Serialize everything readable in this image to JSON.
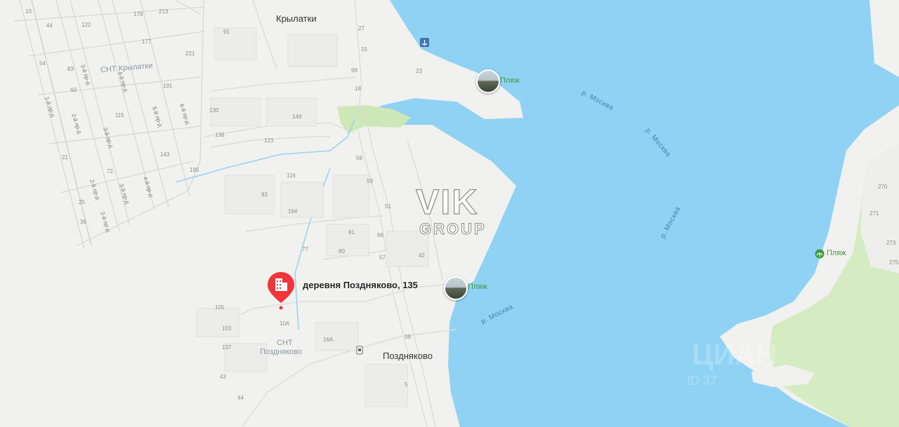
{
  "map": {
    "places": {
      "krylatki": "Крылатки",
      "pozdnyakovo": "Поздняково",
      "snt_krylatki": "СНТ Крылатки",
      "snt_pozdnyakovo_line1": "СНТ",
      "snt_pozdnyakovo_line2": "Поздняково"
    },
    "river_labels": [
      "р. Москва",
      "р. Москва",
      "р. Москва",
      "р. Москва"
    ],
    "beaches": [
      "Пляж",
      "Пляж",
      "Пляж"
    ],
    "address_marker": {
      "label": "деревня Поздняково, 135",
      "icon": "building-icon"
    },
    "watermark": {
      "line1": "VIK",
      "line2": "GROUP"
    },
    "cian_watermark": {
      "text": "ЦИАН",
      "id": "ID 37"
    },
    "streets": [
      "1-й пр-д",
      "2-й пр-д",
      "3-й пр-д",
      "4-й пр-д",
      "5-й пр-д",
      "6-й пр-д",
      "3-й пр-д",
      "2-й пр-д",
      "3-й пр-д",
      "4-й пр-д",
      "2-й пр-д"
    ],
    "house_numbers": [
      "10",
      "44",
      "122",
      "179",
      "213",
      "221",
      "91",
      "27",
      "15",
      "54",
      "60",
      "83",
      "115",
      "191",
      "177",
      "99",
      "18",
      "23",
      "130",
      "136",
      "149",
      "123",
      "21",
      "72",
      "143",
      "185",
      "25",
      "36",
      "56",
      "59",
      "116",
      "93",
      "51",
      "164",
      "81",
      "66",
      "80",
      "77",
      "57",
      "42",
      "105",
      "103",
      "10А",
      "16А",
      "137",
      "38",
      "43",
      "44",
      "5",
      "270",
      "271",
      "273",
      "275"
    ],
    "colors": {
      "water": "#8fd2f4",
      "land": "#f1f1ef",
      "green": "#d7ecc4",
      "marker": "#f0353b",
      "beach_icon": "#3b9a3e"
    }
  }
}
